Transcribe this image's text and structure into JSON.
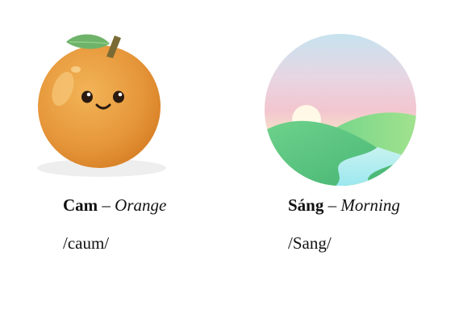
{
  "cards": [
    {
      "icon": "orange-icon",
      "vietnamese": "Cam",
      "separator": " – ",
      "english": "Orange",
      "pronunciation": "/caum/"
    },
    {
      "icon": "morning-landscape-icon",
      "vietnamese": "Sáng",
      "separator": " – ",
      "english": "Morning",
      "pronunciation": "/Sang/"
    }
  ],
  "colors": {
    "orange_body": "#e79a3c",
    "orange_highlight": "#f0b860",
    "leaf": "#6fb36a",
    "stem": "#7a6a35",
    "sky_top": "#bfe6f2",
    "sky_pink": "#f3c6cf",
    "sky_yellow": "#f7ecc4",
    "hill_dark": "#4fc07a",
    "hill_light": "#8ed985",
    "river": "#a8ecf0"
  }
}
